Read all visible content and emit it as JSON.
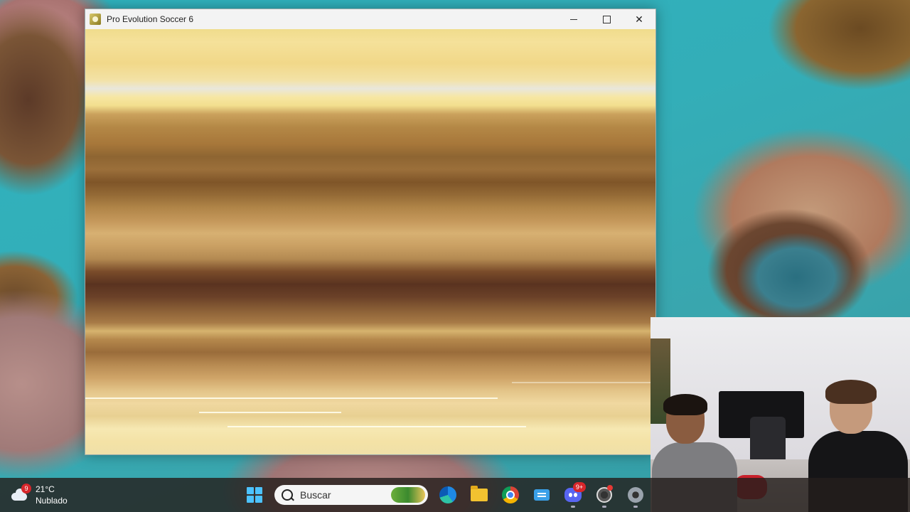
{
  "window": {
    "title": "Pro Evolution Soccer 6",
    "icon": "pes6-app-icon",
    "controls": [
      "minimize",
      "maximize",
      "close"
    ]
  },
  "taskbar": {
    "weather": {
      "badge": "9",
      "temperature": "21°C",
      "condition": "Nublado",
      "icon": "cloud-icon"
    },
    "search": {
      "placeholder": "Buscar"
    },
    "apps": [
      {
        "name": "start",
        "icon": "windows-start-icon"
      },
      {
        "name": "edge",
        "icon": "edge-icon"
      },
      {
        "name": "file-explorer",
        "icon": "folder-icon"
      },
      {
        "name": "chrome",
        "icon": "chrome-icon"
      },
      {
        "name": "messaging",
        "icon": "message-icon"
      },
      {
        "name": "discord",
        "icon": "discord-icon",
        "badge": "9+"
      },
      {
        "name": "obs",
        "icon": "obs-icon"
      },
      {
        "name": "settings",
        "icon": "gear-icon"
      }
    ]
  },
  "colors": {
    "accent": "#4cc2ff",
    "badge": "#d7262b",
    "titlebar": "#f3f3f3"
  }
}
